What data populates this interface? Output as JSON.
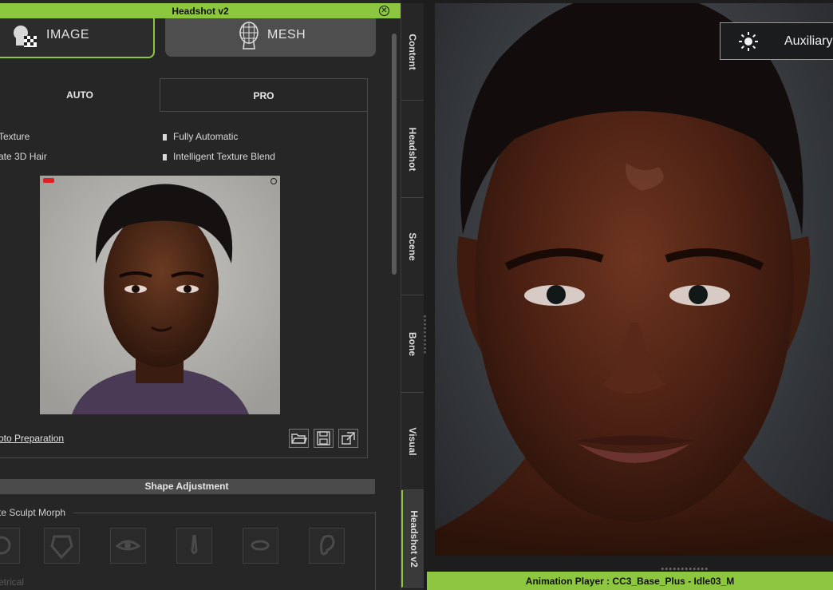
{
  "window": {
    "title": "Headshot v2"
  },
  "modes": {
    "image_label": "IMAGE",
    "mesh_label": "MESH"
  },
  "tabs": {
    "auto": "AUTO",
    "pro": "PRO"
  },
  "options": {
    "col1": [
      "Texture",
      "ate 3D Hair"
    ],
    "col2": [
      "Fully Automatic",
      "Intelligent Texture Blend"
    ]
  },
  "photo_link": "oto Preparation",
  "shape_adjustment": {
    "header": "Shape Adjustment",
    "group_label": "te Sculpt Morph",
    "symmetrical_label": "etrical"
  },
  "side_tabs": [
    "Content",
    "Headshot",
    "Scene",
    "Bone",
    "Visual",
    "Headshot v2"
  ],
  "viewport": {
    "auxiliary_label": "Auxiliary"
  },
  "status_bar": {
    "text": "Animation Player : CC3_Base_Plus - Idle03_M"
  },
  "colors": {
    "accent": "#8dc63f",
    "panel_bg": "#262626",
    "viewport_bg": "#3b3e42"
  },
  "icons": [
    "headshot-image-icon",
    "mesh-head-icon",
    "close-icon",
    "folder-open-icon",
    "save-icon",
    "export-icon",
    "sun-icon"
  ]
}
